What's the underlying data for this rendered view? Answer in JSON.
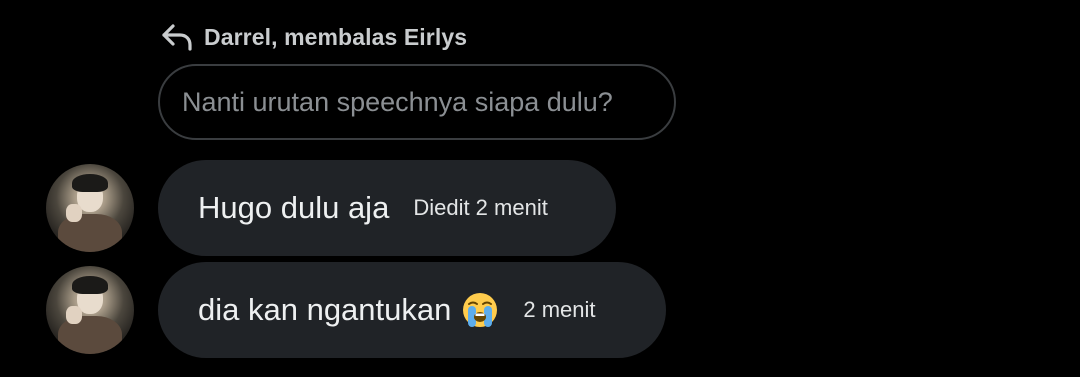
{
  "reply_header": {
    "text": "Darrel, membalas Eirlys",
    "icon": "reply-arrow-icon"
  },
  "quoted_message": {
    "text": "Nanti urutan speechnya siapa dulu?"
  },
  "messages": [
    {
      "text": "Hugo dulu aja",
      "meta": "Diedit 2 menit",
      "avatar": "user-avatar"
    },
    {
      "text": "dia kan ngantukan",
      "emoji": "loudly-crying-face-icon",
      "meta": "2 menit",
      "avatar": "user-avatar"
    }
  ],
  "colors": {
    "background": "#000000",
    "bubble": "#202327",
    "quoted_border": "#3a3d40",
    "quoted_text": "#8b8f93"
  }
}
